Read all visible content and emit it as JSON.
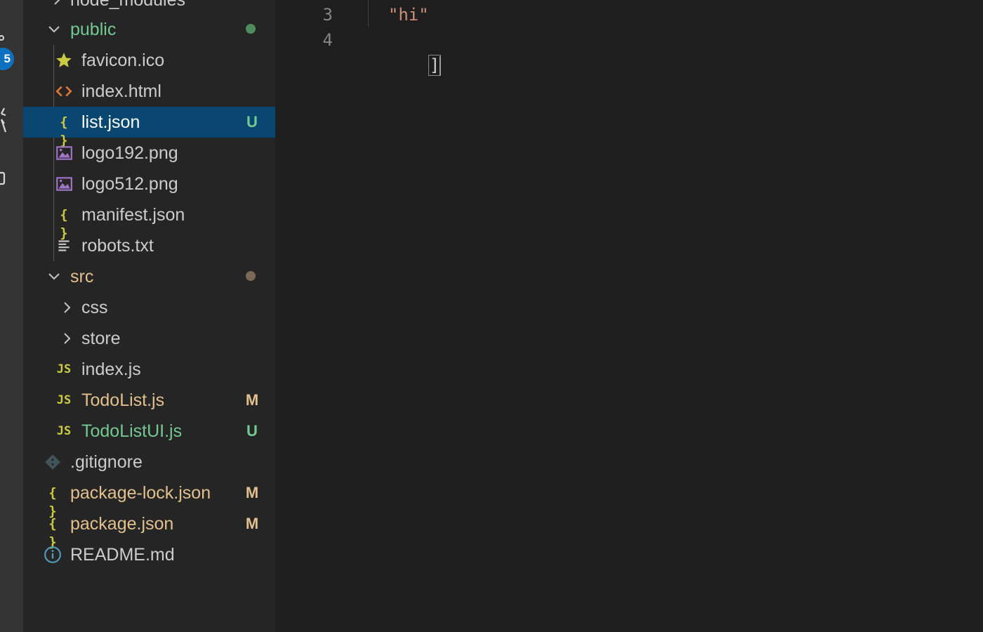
{
  "activity_bar": {
    "badge": "5",
    "icons": [
      "source-control-icon",
      "debug-icon",
      "extensions-icon"
    ]
  },
  "explorer": {
    "top_cutoff_label": "node_modules",
    "items": [
      {
        "label": "public",
        "type": "folder",
        "expanded": true,
        "color": "#73c991",
        "dot": "#4f8b5b"
      },
      {
        "label": "favicon.ico",
        "type": "file",
        "icon": "star-icon",
        "color": "#cccccc"
      },
      {
        "label": "index.html",
        "type": "file",
        "icon": "html-icon",
        "color": "#cccccc"
      },
      {
        "label": "list.json",
        "type": "file",
        "icon": "json-icon",
        "color": "#ffffff",
        "status": "U",
        "status_color": "#73c991",
        "selected": true
      },
      {
        "label": "logo192.png",
        "type": "file",
        "icon": "image-icon",
        "color": "#cccccc"
      },
      {
        "label": "logo512.png",
        "type": "file",
        "icon": "image-icon",
        "color": "#cccccc"
      },
      {
        "label": "manifest.json",
        "type": "file",
        "icon": "json-icon",
        "color": "#cccccc"
      },
      {
        "label": "robots.txt",
        "type": "file",
        "icon": "text-file-icon",
        "color": "#cccccc"
      },
      {
        "label": "src",
        "type": "folder",
        "expanded": true,
        "color": "#e2c08d",
        "dot": "#7a6a55"
      },
      {
        "label": "css",
        "type": "folder",
        "expanded": false,
        "color": "#cccccc"
      },
      {
        "label": "store",
        "type": "folder",
        "expanded": false,
        "color": "#cccccc"
      },
      {
        "label": "index.js",
        "type": "file",
        "icon": "js-icon",
        "color": "#cccccc"
      },
      {
        "label": "TodoList.js",
        "type": "file",
        "icon": "js-icon",
        "color": "#e2c08d",
        "status": "M",
        "status_color": "#e2c08d"
      },
      {
        "label": "TodoListUI.js",
        "type": "file",
        "icon": "js-icon",
        "color": "#73c991",
        "status": "U",
        "status_color": "#73c991"
      },
      {
        "label": ".gitignore",
        "type": "file",
        "icon": "git-icon",
        "color": "#cccccc"
      },
      {
        "label": "package-lock.json",
        "type": "file",
        "icon": "json-icon",
        "color": "#e2c08d",
        "status": "M",
        "status_color": "#e2c08d"
      },
      {
        "label": "package.json",
        "type": "file",
        "icon": "json-icon",
        "color": "#e2c08d",
        "status": "M",
        "status_color": "#e2c08d"
      },
      {
        "label": "README.md",
        "type": "file",
        "icon": "info-icon",
        "color": "#cccccc"
      }
    ]
  },
  "editor": {
    "lines": [
      {
        "number": "3",
        "text": "  \"hi\""
      },
      {
        "number": "4",
        "text": "]"
      }
    ]
  }
}
